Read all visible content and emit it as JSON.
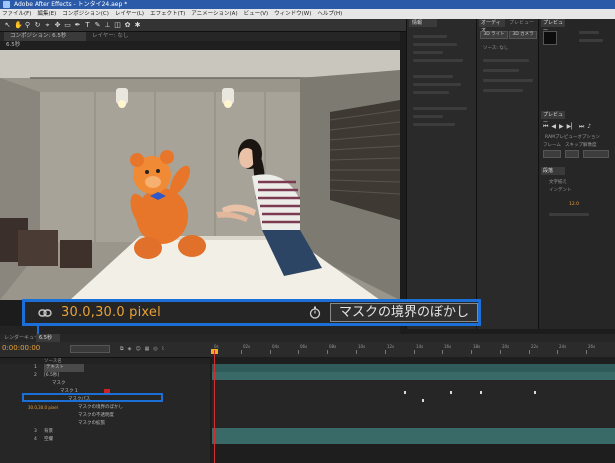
{
  "window": {
    "title": "Adobe After Effects - トンタイ24.aep *"
  },
  "menu": [
    "ファイル(F)",
    "編集(E)",
    "コンポジション(C)",
    "レイヤー(L)",
    "エフェクト(T)",
    "アニメーション(A)",
    "ビュー(V)",
    "ウィンドウ(W)",
    "ヘルプ(H)"
  ],
  "comp_panel": {
    "tab_label": "コンポジション: 6.5秒",
    "layer_tab": "レイヤー: なし",
    "sub_tab": "6.5秒"
  },
  "callout": {
    "value_text": "30.0,30.0 pixel",
    "property_label": "マスクの境界のぼかし"
  },
  "right_panels": {
    "panel_a_tab": "情報",
    "panel_b_tabs": [
      "オーディオ",
      "プレビュー"
    ],
    "panel_b_buttons": [
      "3D ライト",
      "3D カメラ"
    ],
    "panel_b_text": "ソース: なし",
    "preview_tab": "プレビュー",
    "preview_items": [
      "RAMプレビューオプション",
      "フレーム",
      "スキップ",
      "解像度"
    ],
    "paragraph_tab": "段落",
    "paragraph_items": [
      "文字揃え",
      "インデント"
    ],
    "paragraph_value": "12.0"
  },
  "timeline": {
    "tab_render": "レンダーキュー",
    "tab_comp": "6.5秒",
    "timecode": "0:00:00:00",
    "col_header": "ソース名",
    "layers": [
      {
        "num": "1",
        "name": "テキスト"
      },
      {
        "num": "2",
        "name": "[6.5秒]"
      },
      {
        "num": "",
        "name": "マスク"
      },
      {
        "num": "",
        "name": "マスク 1"
      },
      {
        "num": "",
        "name": "マスクパス"
      },
      {
        "num": "",
        "name": "マスクの境界のぼかし"
      },
      {
        "num": "",
        "name": "マスクの不透明度"
      },
      {
        "num": "",
        "name": "マスクの拡張"
      },
      {
        "num": "3",
        "name": "背景"
      },
      {
        "num": "4",
        "name": "空撮"
      }
    ],
    "box_value": "30.0,30.0 pixel",
    "ruler": [
      "0s",
      "02s",
      "04s",
      "06s",
      "08s",
      "10s",
      "12s",
      "14s",
      "16s",
      "18s",
      "20s",
      "22s",
      "24s",
      "26s"
    ]
  },
  "colors": {
    "accent_blue": "#1b6fd6",
    "timecode_orange": "#e8a23a",
    "playhead_red": "#d23030"
  }
}
